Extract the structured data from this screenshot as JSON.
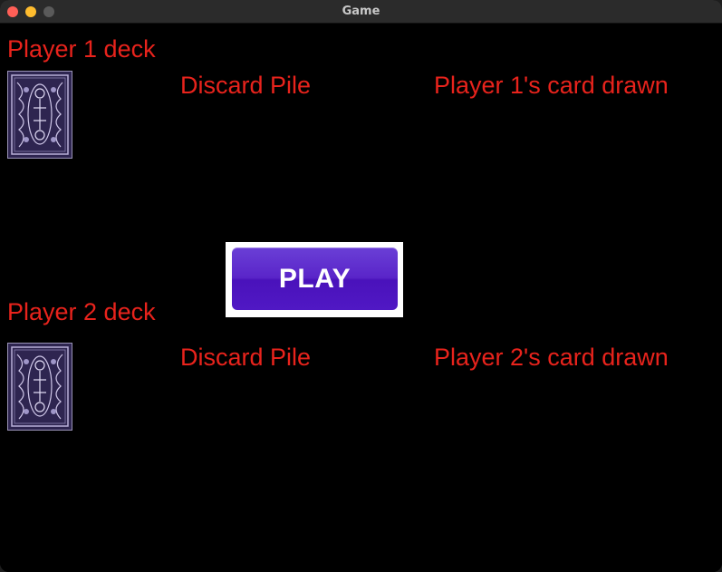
{
  "window": {
    "title": "Game"
  },
  "player1": {
    "deck_label": "Player 1 deck",
    "discard_label": "Discard Pile",
    "drawn_label": "Player 1's card drawn"
  },
  "player2": {
    "deck_label": "Player 2 deck",
    "discard_label": "Discard Pile",
    "drawn_label": "Player 2's card drawn"
  },
  "play_button": {
    "label": "PLAY"
  },
  "colors": {
    "background": "#000000",
    "label_text": "#e8231c",
    "button_purple": "#5018c4",
    "card_back": "#2e2550"
  },
  "icons": {
    "card_back": "card-back-icon"
  }
}
